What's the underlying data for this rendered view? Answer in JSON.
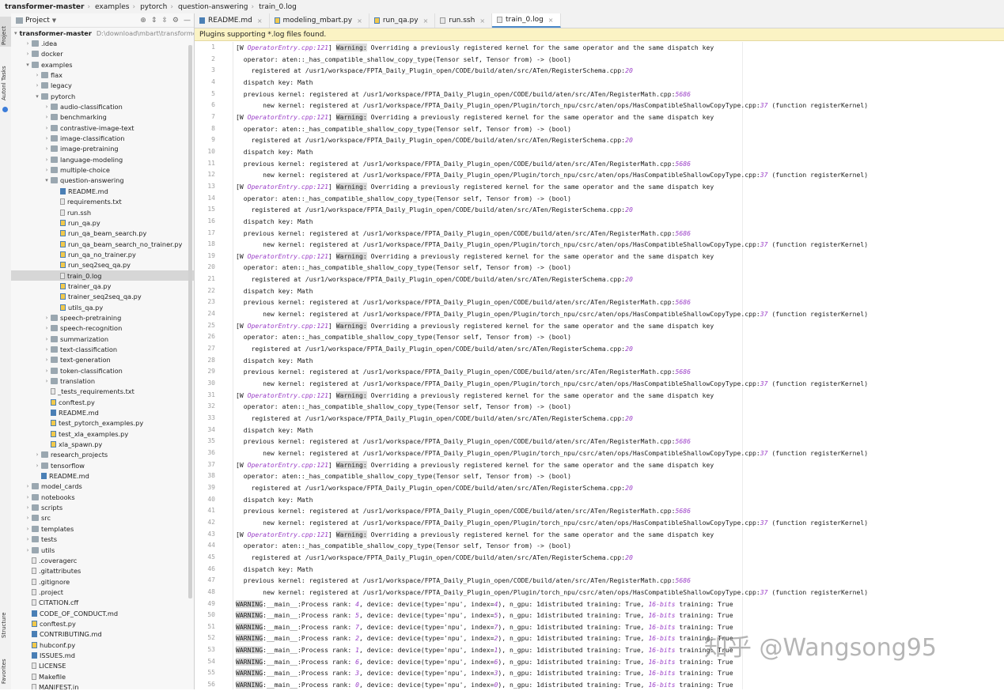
{
  "breadcrumb": [
    "transformer-master",
    "examples",
    "pytorch",
    "question-answering",
    "train_0.log"
  ],
  "tool_strip": {
    "project": "Project",
    "autonl": "Autonl Tasks",
    "structure": "Structure",
    "favorites": "Favorites"
  },
  "project_panel": {
    "title": "Project",
    "tree": [
      {
        "d": 0,
        "a": "v",
        "t": "folder",
        "label": "transformer-master",
        "path": "D:\\download\\mbart\\transforme",
        "bold": true
      },
      {
        "d": 1,
        "a": ">",
        "t": "folder",
        "label": ".idea"
      },
      {
        "d": 1,
        "a": ">",
        "t": "folder",
        "label": "docker"
      },
      {
        "d": 1,
        "a": "v",
        "t": "folder",
        "label": "examples"
      },
      {
        "d": 2,
        "a": ">",
        "t": "folder",
        "label": "flax"
      },
      {
        "d": 2,
        "a": ">",
        "t": "folder",
        "label": "legacy"
      },
      {
        "d": 2,
        "a": "v",
        "t": "folder",
        "label": "pytorch"
      },
      {
        "d": 3,
        "a": ">",
        "t": "folder",
        "label": "audio-classification"
      },
      {
        "d": 3,
        "a": ">",
        "t": "folder",
        "label": "benchmarking"
      },
      {
        "d": 3,
        "a": ">",
        "t": "folder",
        "label": "contrastive-image-text"
      },
      {
        "d": 3,
        "a": ">",
        "t": "folder",
        "label": "image-classification"
      },
      {
        "d": 3,
        "a": ">",
        "t": "folder",
        "label": "image-pretraining"
      },
      {
        "d": 3,
        "a": ">",
        "t": "folder",
        "label": "language-modeling"
      },
      {
        "d": 3,
        "a": ">",
        "t": "folder",
        "label": "multiple-choice"
      },
      {
        "d": 3,
        "a": "v",
        "t": "folder",
        "label": "question-answering"
      },
      {
        "d": 4,
        "a": "",
        "t": "md",
        "label": "README.md"
      },
      {
        "d": 4,
        "a": "",
        "t": "file",
        "label": "requirements.txt"
      },
      {
        "d": 4,
        "a": "",
        "t": "file",
        "label": "run.ssh"
      },
      {
        "d": 4,
        "a": "",
        "t": "py",
        "label": "run_qa.py"
      },
      {
        "d": 4,
        "a": "",
        "t": "py",
        "label": "run_qa_beam_search.py"
      },
      {
        "d": 4,
        "a": "",
        "t": "py",
        "label": "run_qa_beam_search_no_trainer.py"
      },
      {
        "d": 4,
        "a": "",
        "t": "py",
        "label": "run_qa_no_trainer.py"
      },
      {
        "d": 4,
        "a": "",
        "t": "py",
        "label": "run_seq2seq_qa.py"
      },
      {
        "d": 4,
        "a": "",
        "t": "file",
        "label": "train_0.log",
        "selected": true
      },
      {
        "d": 4,
        "a": "",
        "t": "py",
        "label": "trainer_qa.py"
      },
      {
        "d": 4,
        "a": "",
        "t": "py",
        "label": "trainer_seq2seq_qa.py"
      },
      {
        "d": 4,
        "a": "",
        "t": "py",
        "label": "utils_qa.py"
      },
      {
        "d": 3,
        "a": ">",
        "t": "folder",
        "label": "speech-pretraining"
      },
      {
        "d": 3,
        "a": ">",
        "t": "folder",
        "label": "speech-recognition"
      },
      {
        "d": 3,
        "a": ">",
        "t": "folder",
        "label": "summarization"
      },
      {
        "d": 3,
        "a": ">",
        "t": "folder",
        "label": "text-classification"
      },
      {
        "d": 3,
        "a": ">",
        "t": "folder",
        "label": "text-generation"
      },
      {
        "d": 3,
        "a": ">",
        "t": "folder",
        "label": "token-classification"
      },
      {
        "d": 3,
        "a": ">",
        "t": "folder",
        "label": "translation"
      },
      {
        "d": 3,
        "a": "",
        "t": "file",
        "label": "_tests_requirements.txt"
      },
      {
        "d": 3,
        "a": "",
        "t": "py",
        "label": "conftest.py"
      },
      {
        "d": 3,
        "a": "",
        "t": "md",
        "label": "README.md"
      },
      {
        "d": 3,
        "a": "",
        "t": "py",
        "label": "test_pytorch_examples.py"
      },
      {
        "d": 3,
        "a": "",
        "t": "py",
        "label": "test_xla_examples.py"
      },
      {
        "d": 3,
        "a": "",
        "t": "py",
        "label": "xla_spawn.py"
      },
      {
        "d": 2,
        "a": ">",
        "t": "folder",
        "label": "research_projects"
      },
      {
        "d": 2,
        "a": ">",
        "t": "folder",
        "label": "tensorflow"
      },
      {
        "d": 2,
        "a": "",
        "t": "md",
        "label": "README.md"
      },
      {
        "d": 1,
        "a": ">",
        "t": "folder",
        "label": "model_cards"
      },
      {
        "d": 1,
        "a": ">",
        "t": "folder",
        "label": "notebooks"
      },
      {
        "d": 1,
        "a": ">",
        "t": "folder",
        "label": "scripts"
      },
      {
        "d": 1,
        "a": ">",
        "t": "folder",
        "label": "src"
      },
      {
        "d": 1,
        "a": ">",
        "t": "folder",
        "label": "templates"
      },
      {
        "d": 1,
        "a": ">",
        "t": "folder",
        "label": "tests"
      },
      {
        "d": 1,
        "a": ">",
        "t": "folder",
        "label": "utils"
      },
      {
        "d": 1,
        "a": "",
        "t": "file",
        "label": ".coveragerc"
      },
      {
        "d": 1,
        "a": "",
        "t": "file",
        "label": ".gitattributes"
      },
      {
        "d": 1,
        "a": "",
        "t": "file",
        "label": ".gitignore"
      },
      {
        "d": 1,
        "a": "",
        "t": "file",
        "label": ".project"
      },
      {
        "d": 1,
        "a": "",
        "t": "file",
        "label": "CITATION.cff"
      },
      {
        "d": 1,
        "a": "",
        "t": "md",
        "label": "CODE_OF_CONDUCT.md"
      },
      {
        "d": 1,
        "a": "",
        "t": "py",
        "label": "conftest.py"
      },
      {
        "d": 1,
        "a": "",
        "t": "md",
        "label": "CONTRIBUTING.md"
      },
      {
        "d": 1,
        "a": "",
        "t": "py",
        "label": "hubconf.py"
      },
      {
        "d": 1,
        "a": "",
        "t": "md",
        "label": "ISSUES.md"
      },
      {
        "d": 1,
        "a": "",
        "t": "file",
        "label": "LICENSE"
      },
      {
        "d": 1,
        "a": "",
        "t": "file",
        "label": "Makefile"
      },
      {
        "d": 1,
        "a": "",
        "t": "file",
        "label": "MANIFEST.in"
      }
    ]
  },
  "tabs": [
    {
      "label": "README.md",
      "icon": "md",
      "active": false
    },
    {
      "label": "modeling_mbart.py",
      "icon": "py",
      "active": false
    },
    {
      "label": "run_qa.py",
      "icon": "py",
      "active": false
    },
    {
      "label": "run.ssh",
      "icon": "file",
      "active": false
    },
    {
      "label": "train_0.log",
      "icon": "file",
      "active": true
    }
  ],
  "banner": "Plugins supporting *.log files found.",
  "log_block": {
    "warn_prefix": "[W ",
    "src": "OperatorEntry.cpp:121",
    "close": "] ",
    "warning": "Warning:",
    "warn_msg": " Overriding a previously registered kernel for the same operator and the same dispatch key",
    "operator": "  operator: aten::_has_compatible_shallow_copy_type(Tensor self, Tensor from) -> (bool)",
    "registered_pre": "    registered at /usr1/workspace/FPTA_Daily_Plugin_open/CODE/build/aten/src/ATen/RegisterSchema.cpp:",
    "registered_num": "20",
    "dispatch": "  dispatch key: Math",
    "previous_pre": "  previous kernel: registered at /usr1/workspace/FPTA_Daily_Plugin_open/CODE/build/aten/src/ATen/RegisterMath.cpp:",
    "previous_num": "5686",
    "new_pre": "       new kernel: registered at /usr1/workspace/FPTA_Daily_Plugin_open/Plugin/torch_npu/csrc/aten/ops/HasCompatibleShallowCopyType.cpp:",
    "new_num": "37",
    "new_post": " (function registerKernel)"
  },
  "process_lines": [
    {
      "rank": "4",
      "index": "4"
    },
    {
      "rank": "5",
      "index": "5"
    },
    {
      "rank": "7",
      "index": "7"
    },
    {
      "rank": "2",
      "index": "2"
    },
    {
      "rank": "1",
      "index": "1"
    },
    {
      "rank": "6",
      "index": "6"
    },
    {
      "rank": "3",
      "index": "3"
    },
    {
      "rank": "0",
      "index": "0"
    }
  ],
  "process_parts": {
    "warning": "WARNING",
    "mid": ":__main__:Process rank: ",
    "device": ", device: device(type=",
    "npu": "'npu'",
    "index": ", index=",
    "tail": "), n_gpu: 1distributed training: True, ",
    "bits": "16-bits",
    "end": " training: True"
  },
  "watermark": "知乎 @Wangsong95"
}
